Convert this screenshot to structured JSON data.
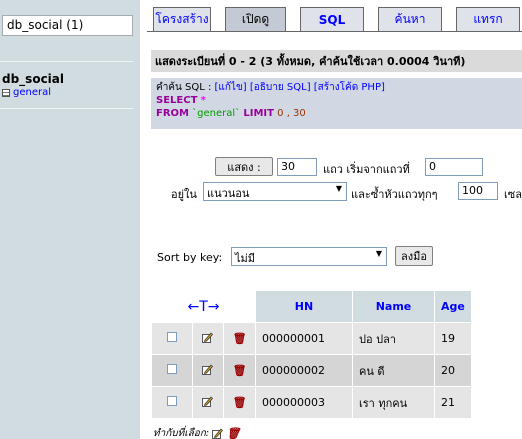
{
  "left": {
    "db_select_value": "db_social (1)",
    "db_name": "db_social",
    "tables": [
      {
        "label": "general"
      }
    ]
  },
  "tabs": [
    {
      "label": "โครงสร้าง",
      "active": false
    },
    {
      "label": "เปิดดู",
      "active": true
    },
    {
      "label": "SQL",
      "active": false
    },
    {
      "label": "ค้นหา",
      "active": false
    },
    {
      "label": "แทรก",
      "active": false
    }
  ],
  "showing_text": "แสดงระเบียนที่ 0 - 2 (3 ทั้งหมด, คำค้นใช้เวลา 0.0004 วินาที)",
  "sql": {
    "prefix": "คำค้น SQL : ",
    "edit_link": "[แก้ไข]",
    "explain_link": "[อธิบาย SQL]",
    "php_link": "[สร้างโค้ด PHP]",
    "line1_kw": "SELECT",
    "line1_star": "*",
    "line2_kw_from": "FROM",
    "line2_table": "`general`",
    "line2_kw_limit": "LIMIT",
    "line2_limit": "0 , 30"
  },
  "nav": {
    "show_button": "แสดง :",
    "rows_value": "30",
    "rows_text": "แถว เริ่มจากแถวที่",
    "start_value": "0",
    "mode_label": "อยู่ใน",
    "mode_value": "แนวนอน",
    "repeat_text": "และซ้ำหัวแถวทุกๆ",
    "repeat_value": "100",
    "cells_text": "เซล"
  },
  "sort": {
    "label": "Sort by key:",
    "value": "ไม่มี",
    "button": "ลงมือ"
  },
  "table": {
    "arrows": "←T→",
    "columns": [
      "HN",
      "Name",
      "Age"
    ],
    "rows": [
      {
        "hn": "000000001",
        "name": "ปอ ปลา",
        "age": "19"
      },
      {
        "hn": "000000002",
        "name": "คน ดี",
        "age": "20"
      },
      {
        "hn": "000000003",
        "name": "เรา ทุกคน",
        "age": "21"
      }
    ]
  },
  "with_selected": "ทำกับที่เลือก:"
}
